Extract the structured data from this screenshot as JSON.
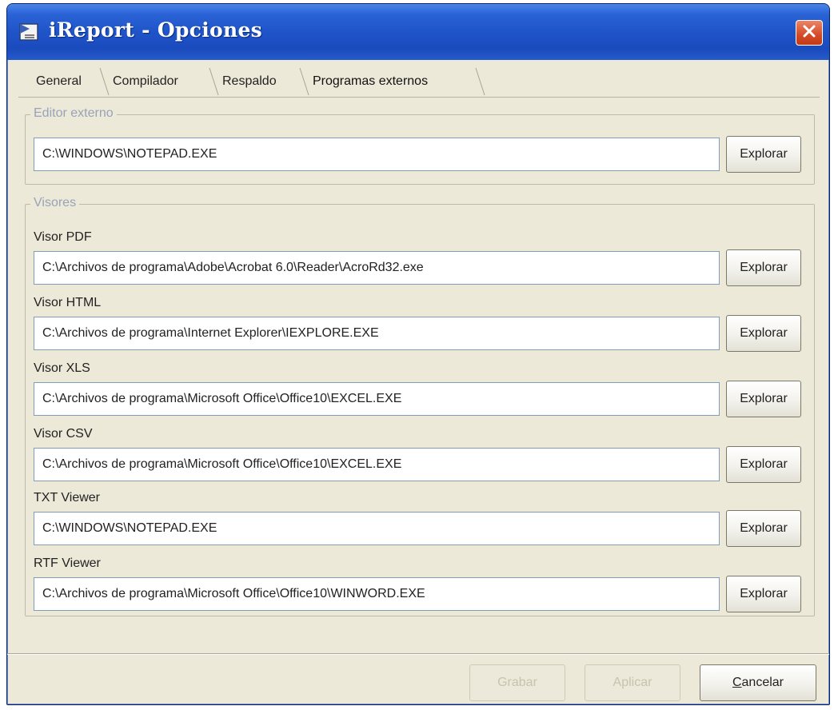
{
  "window": {
    "title": "iReport - Opciones"
  },
  "tabs": [
    {
      "label": "General",
      "active": false
    },
    {
      "label": "Compilador",
      "active": false
    },
    {
      "label": "Respaldo",
      "active": false
    },
    {
      "label": "Programas externos",
      "active": true
    }
  ],
  "editor_group": {
    "legend": "Editor externo",
    "path": "C:\\WINDOWS\\NOTEPAD.EXE",
    "button_label": "Explorar"
  },
  "viewers_group": {
    "legend": "Visores",
    "items": [
      {
        "label": "Visor PDF",
        "path": "C:\\Archivos de programa\\Adobe\\Acrobat 6.0\\Reader\\AcroRd32.exe",
        "button_label": "Explorar"
      },
      {
        "label": "Visor HTML",
        "path": "C:\\Archivos de programa\\Internet Explorer\\IEXPLORE.EXE",
        "button_label": "Explorar"
      },
      {
        "label": "Visor XLS",
        "path": "C:\\Archivos de programa\\Microsoft Office\\Office10\\EXCEL.EXE",
        "button_label": "Explorar"
      },
      {
        "label": "Visor CSV",
        "path": "C:\\Archivos de programa\\Microsoft Office\\Office10\\EXCEL.EXE",
        "button_label": "Explorar"
      },
      {
        "label": "TXT Viewer",
        "path": "C:\\WINDOWS\\NOTEPAD.EXE",
        "button_label": "Explorar"
      },
      {
        "label": "RTF Viewer",
        "path": "C:\\Archivos de programa\\Microsoft Office\\Office10\\WINWORD.EXE",
        "button_label": "Explorar"
      }
    ]
  },
  "footer": {
    "save_label": "Grabar",
    "apply_label": "Aplicar",
    "cancel_label": "Cancelar",
    "cancel_mnemonic": "C",
    "cancel_rest": "ancelar"
  },
  "colors": {
    "titlebar": "#1f54c9",
    "dialog_bg": "#ece9d8",
    "close_button": "#d54a26",
    "legend_text": "#9aa2b8"
  },
  "icons": {
    "title": "report-document-icon",
    "close": "close-icon"
  }
}
